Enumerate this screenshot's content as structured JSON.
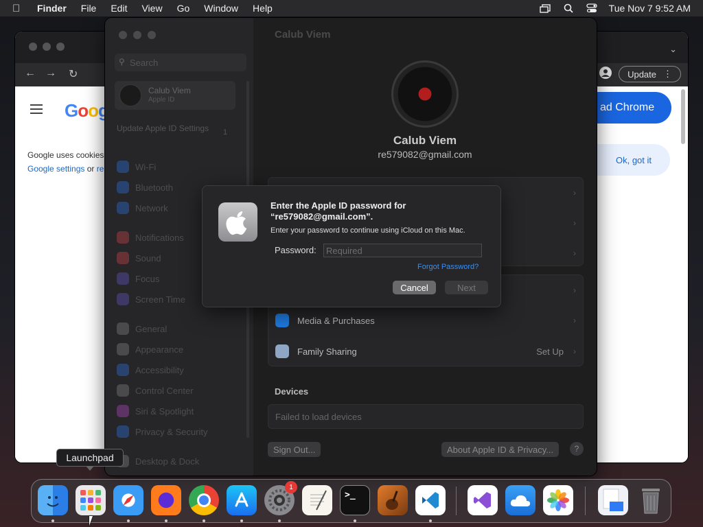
{
  "menubar": {
    "app": "Finder",
    "items": [
      "File",
      "Edit",
      "View",
      "Go",
      "Window",
      "Help"
    ],
    "clock": "Tue Nov 7  9:52 AM"
  },
  "chrome": {
    "update_label": "Update",
    "download_label": "ad Chrome",
    "ok_label": "Ok, got it",
    "google_logo": "Goog",
    "cookie_line1": "Google uses cookies",
    "cookie_link1": "Google settings",
    "cookie_or": " or ",
    "cookie_link2": "re"
  },
  "settings": {
    "window_title": "Calub Viem",
    "search_placeholder": "Search",
    "account_name": "Calub Viem",
    "account_sub": "Apple ID",
    "update_text": "Update Apple ID Settings",
    "update_badge": "1",
    "sidebar": [
      {
        "label": "Wi-Fi",
        "color": "#2f7bf5"
      },
      {
        "label": "Bluetooth",
        "color": "#2f7bf5"
      },
      {
        "label": "Network",
        "color": "#2f7bf5"
      },
      {
        "label": "Notifications",
        "color": "#e5484d"
      },
      {
        "label": "Sound",
        "color": "#e5484d"
      },
      {
        "label": "Focus",
        "color": "#6a5cd6"
      },
      {
        "label": "Screen Time",
        "color": "#6a5cd6"
      },
      {
        "label": "General",
        "color": "#8e8e93"
      },
      {
        "label": "Appearance",
        "color": "#8e8e93"
      },
      {
        "label": "Accessibility",
        "color": "#2f7bf5"
      },
      {
        "label": "Control Center",
        "color": "#8e8e93"
      },
      {
        "label": "Siri & Spotlight",
        "color": "#c74bd6"
      },
      {
        "label": "Privacy & Security",
        "color": "#2f7bf5"
      },
      {
        "label": "Desktop & Dock",
        "color": "#8e8e93"
      }
    ],
    "user_name": "Calub Viem",
    "user_email": "re579082@gmail.com",
    "media_label": "Media & Purchases",
    "family_label": "Family Sharing",
    "family_trail": "Set Up",
    "devices_heading": "Devices",
    "devices_text": "Failed to load devices",
    "signout_label": "Sign Out...",
    "about_label": "About Apple ID & Privacy...",
    "help_label": "?"
  },
  "sheet": {
    "title": "Enter the Apple ID password for “re579082@gmail.com”.",
    "subtitle": "Enter your password to continue using iCloud on this Mac.",
    "password_label": "Password:",
    "password_placeholder": "Required",
    "forgot_label": "Forgot Password?",
    "cancel_label": "Cancel",
    "next_label": "Next"
  },
  "dock": {
    "tooltip": "Launchpad",
    "settings_badge": "1",
    "items": [
      "finder-icon",
      "launchpad-icon",
      "safari-icon",
      "firefox-icon",
      "chrome-icon",
      "app-store-icon",
      "system-settings-icon",
      "textedit-icon",
      "terminal-icon",
      "garageband-icon",
      "vscode-icon",
      "visual-studio-icon",
      "icloud-icon",
      "photos-icon",
      "downloads-stack-icon",
      "trash-icon"
    ]
  }
}
